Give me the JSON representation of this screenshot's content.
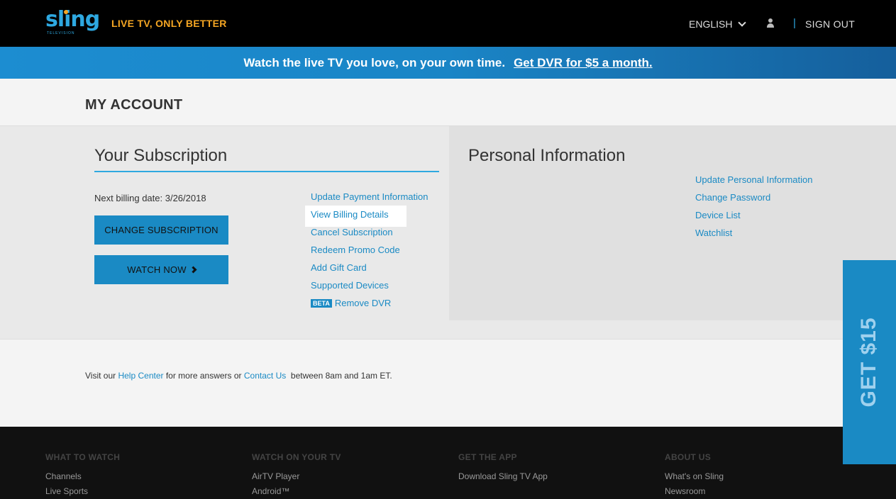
{
  "header": {
    "logo_text": "sling",
    "logo_sub": "TELEVISION",
    "tagline": "LIVE TV, ONLY BETTER",
    "language": "ENGLISH",
    "separator": "|",
    "sign_out": "SIGN OUT"
  },
  "promo": {
    "text": "Watch the live TV you love, on your own time.",
    "cta": "Get DVR for $5 a month."
  },
  "page": {
    "title": "MY ACCOUNT"
  },
  "subscription": {
    "title": "Your Subscription",
    "billing": "Next billing date: 3/26/2018",
    "change_button": "CHANGE SUBSCRIPTION",
    "watch_button": "WATCH NOW",
    "links": [
      "Update Payment Information",
      "View Billing Details",
      "Cancel Subscription",
      "Redeem Promo Code",
      "Add Gift Card",
      "Supported Devices"
    ],
    "beta_badge": "BETA",
    "dvr_link": "Remove DVR"
  },
  "personal": {
    "title": "Personal Information",
    "links": [
      "Update Personal Information",
      "Change Password",
      "Device List",
      "Watchlist"
    ]
  },
  "help": {
    "pre": "Visit our ",
    "help_center": "Help Center",
    "mid": " for more answers or ",
    "contact": "Contact Us",
    "post": "  between 8am and 1am ET."
  },
  "footer": {
    "columns": [
      {
        "heading": "WHAT TO WATCH",
        "items": [
          "Channels",
          "Live Sports"
        ]
      },
      {
        "heading": "WATCH ON YOUR TV",
        "items": [
          "AirTV Player",
          "Android™"
        ]
      },
      {
        "heading": "GET THE APP",
        "items": [
          "Download Sling TV App"
        ]
      },
      {
        "heading": "ABOUT US",
        "items": [
          "What's on Sling",
          "Newsroom"
        ]
      }
    ]
  },
  "sidetab": {
    "label": "GET $15"
  },
  "colors": {
    "accent": "#1a8ac4",
    "brand_orange": "#f5a623",
    "topbar": "#000000"
  }
}
